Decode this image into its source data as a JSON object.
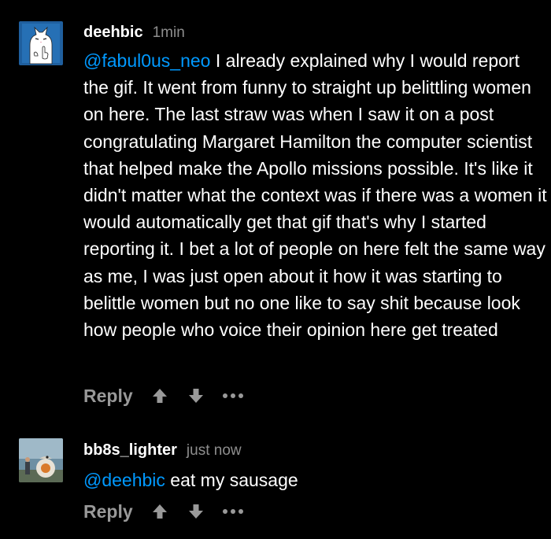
{
  "comments": [
    {
      "username": "deehbic",
      "timestamp": "1min",
      "mention": "@fabul0us_neo",
      "text": " I already explained why I would report the gif. It went from funny to straight up belittling women on here. The last straw was when I saw it on a post congratulating Margaret Hamilton the computer scientist that helped make the Apollo missions possible. It's like it didn't matter what the context was if there was a women it would automatically get that gif that's why I started reporting it. I bet a lot of people on here felt the same way as me, I was just open about it how it was starting to belittle women but no one like to say shit because look how people who voice their opinion here get treated",
      "reply_label": "Reply"
    },
    {
      "username": "bb8s_lighter",
      "timestamp": "just now",
      "mention": "@deehbic",
      "text": " eat my sausage",
      "reply_label": "Reply"
    }
  ],
  "colors": {
    "background": "#000000",
    "mention": "#0099ff",
    "timestamp": "#8e8e8e",
    "action": "#999999"
  },
  "icons": {
    "upvote": "upvote-arrow-icon",
    "downvote": "downvote-arrow-icon",
    "more": "more-dots-icon"
  }
}
